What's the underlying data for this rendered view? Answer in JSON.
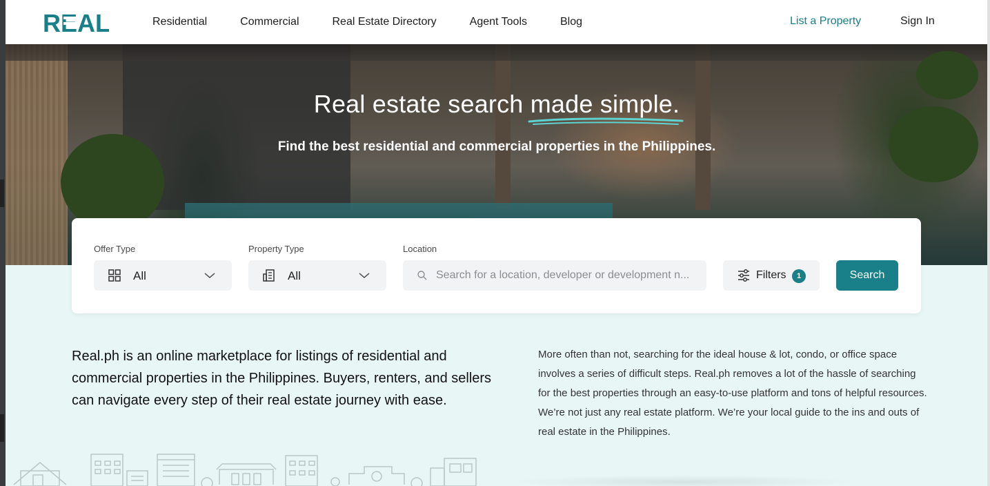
{
  "brand": {
    "logo_text": "REAL",
    "accent": "#197f89"
  },
  "nav": {
    "items": [
      "Residential",
      "Commercial",
      "Real Estate Directory",
      "Agent Tools",
      "Blog"
    ],
    "list_property": "List a Property",
    "sign_in": "Sign In"
  },
  "hero": {
    "title_plain": "Real estate search ",
    "title_underlined": "made simple.",
    "subtitle": "Find the best residential and commercial properties in the Philippines."
  },
  "search": {
    "offer_type": {
      "label": "Offer Type",
      "value": "All",
      "icon": "grid-icon"
    },
    "property_type": {
      "label": "Property Type",
      "value": "All",
      "icon": "building-icon"
    },
    "location": {
      "label": "Location",
      "placeholder": "Search for a location, developer or development n..."
    },
    "filters": {
      "label": "Filters",
      "count": "1"
    },
    "submit": "Search"
  },
  "intro": {
    "lead": "Real.ph is an online marketplace for listings of residential and commercial properties in the Philippines. Buyers, renters, and sellers can navigate every step of their real estate journey with ease.",
    "body": "More often than not, searching for the ideal house & lot, condo, or office space involves a series of difficult steps. Real.ph removes a lot of the hassle of searching for the best properties through an easy-to-use platform and tons of helpful resources. We’re not just any real estate platform. We’re your local guide to the ins and outs of real estate in the Philippines."
  }
}
